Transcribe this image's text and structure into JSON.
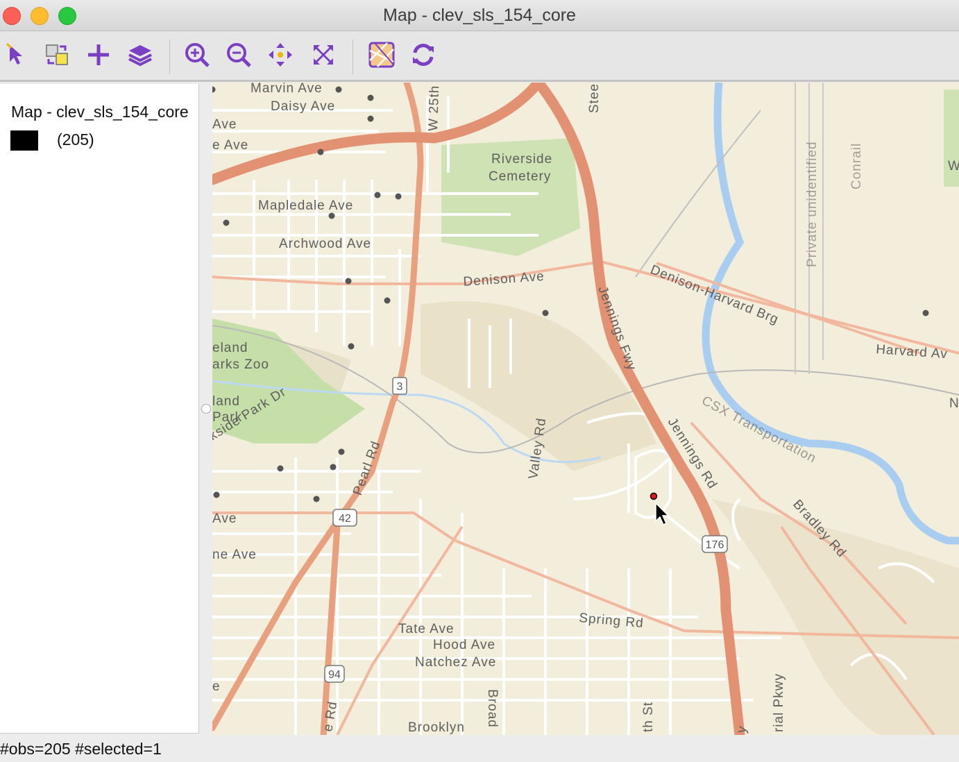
{
  "window": {
    "title": "Map - clev_sls_154_core"
  },
  "toolbar": {
    "tools": [
      {
        "id": "select",
        "icon": "select-arrow-icon"
      },
      {
        "id": "swap",
        "icon": "swap-layers-icon"
      },
      {
        "id": "add-layer",
        "icon": "plus-icon"
      },
      {
        "id": "layers",
        "icon": "layers-stack-icon"
      },
      {
        "id": "zoom-in",
        "icon": "zoom-in-icon"
      },
      {
        "id": "zoom-out",
        "icon": "zoom-out-icon"
      },
      {
        "id": "pan",
        "icon": "pan-arrows-icon"
      },
      {
        "id": "full-extent",
        "icon": "full-extent-icon"
      },
      {
        "id": "basemap",
        "icon": "basemap-icon"
      },
      {
        "id": "refresh",
        "icon": "refresh-icon"
      }
    ],
    "accent_color": "#7a3fc2"
  },
  "legend": {
    "title": "Map - clev_sls_154_core",
    "swatch_color": "#000000",
    "count_label": "(205)"
  },
  "map": {
    "street_labels": [
      "Marvin Ave",
      "Daisy Ave",
      "Ave",
      "e Ave",
      "W 25th",
      "Stee",
      "Riverside",
      "Cemetery",
      "Mapledale Ave",
      "Archwood Ave",
      "Denison Ave",
      "Jennings Fwy",
      "Denison-Harvard Brg",
      "Harvard Av",
      "eland",
      "arks Zoo",
      "land",
      "Park",
      "kside Park Dr",
      "Pearl Rd",
      "Valley Rd",
      "Jennings Rd",
      "CSX Transportation",
      "Bradley Rd",
      "Ave",
      "ne Ave",
      "Tate Ave",
      "Hood Ave",
      "Natchez Ave",
      "Spring Rd",
      "Brooklyn",
      "Broad",
      "th St",
      "rial Pkwy",
      "e Rd",
      "e",
      "Private unidentified",
      "Conrail",
      "W",
      "N",
      "y"
    ],
    "route_shields": [
      "3",
      "42",
      "176",
      "94"
    ],
    "colors": {
      "land": "#f2eedb",
      "highway": "#e8a07e",
      "street": "#ffffff",
      "water": "#a8cdf0",
      "park": "#c9dfae",
      "point": "#555555",
      "selected": "#e8141c"
    }
  },
  "status": {
    "text": "#obs=205 #selected=1"
  }
}
